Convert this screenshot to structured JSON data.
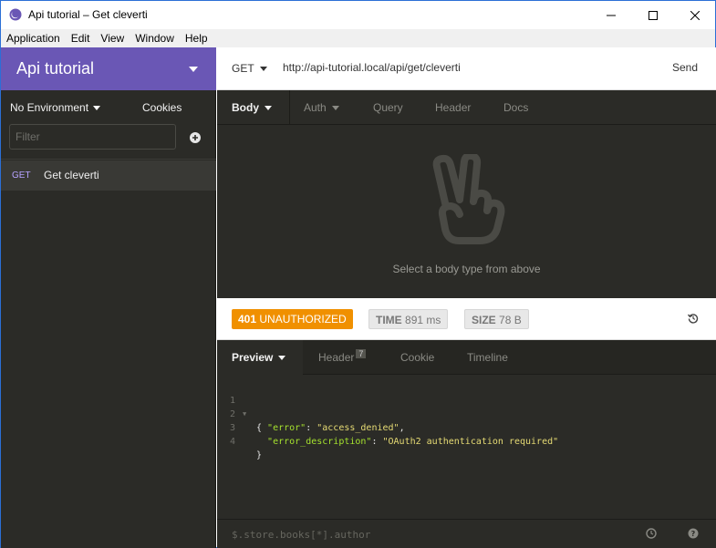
{
  "window": {
    "title": "Api tutorial – Get cleverti"
  },
  "menu": [
    "Application",
    "Edit",
    "View",
    "Window",
    "Help"
  ],
  "sidebar": {
    "workspace": "Api tutorial",
    "environment": "No Environment",
    "cookies": "Cookies",
    "filter_placeholder": "Filter",
    "requests": [
      {
        "method": "GET",
        "name": "Get cleverti"
      }
    ]
  },
  "urlbar": {
    "method": "GET",
    "url": "http://api-tutorial.local/api/get/cleverti",
    "send": "Send"
  },
  "request_tabs": [
    "Body",
    "Auth",
    "Query",
    "Header",
    "Docs"
  ],
  "request_empty_message": "Select a body type from above",
  "response": {
    "status_code": "401",
    "status_text": "UNAUTHORIZED",
    "time_label": "TIME",
    "time_value": "891 ms",
    "size_label": "SIZE",
    "size_value": "78 B",
    "tabs": [
      "Preview",
      "Header",
      "Cookie",
      "Timeline"
    ],
    "header_count": "7",
    "lines": [
      {
        "n": "1",
        "text": "{"
      },
      {
        "n": "2",
        "key": "\"error\"",
        "value": "\"access_denied\"",
        "trail": ","
      },
      {
        "n": "3",
        "key": "\"error_description\"",
        "value": "\"OAuth2 authentication required\"",
        "trail": ""
      },
      {
        "n": "4",
        "text": "}"
      }
    ],
    "filter_placeholder": "$.store.books[*].author"
  },
  "colors": {
    "accent": "#6a57b5",
    "status_401": "#f09000",
    "panel": "#2b2b27"
  }
}
